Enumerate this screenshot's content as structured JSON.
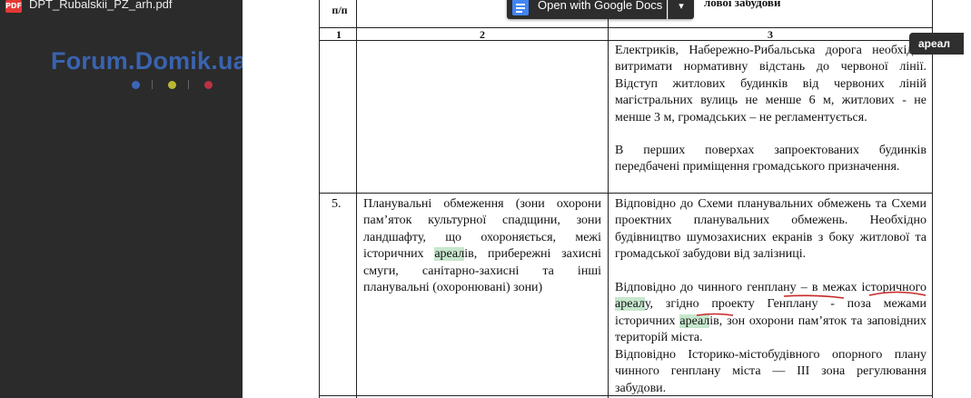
{
  "viewer": {
    "file_name": "DPT_Rubalskii_PZ_arh.pdf",
    "file_badge": "PDF",
    "open_with_label": "Open with Google Docs",
    "dropdown_glyph": "▾",
    "search_term": "ареал"
  },
  "watermark": {
    "text": "Forum.Domik.ua",
    "dot_colors": [
      "#3b66b8",
      "#b8b832",
      "#b83244"
    ]
  },
  "table": {
    "header_col1": "п/п",
    "header_partial_title": "лової забудови",
    "col_numbers": [
      "1",
      "2",
      "3"
    ],
    "row4_col3": "Електриків, Набережно-Рибальська дорога необхідно витримати нормативну відстань до червоної лінії. Відступ житлових будинків від червоних ліній магістральних вулиць не менше 6 м, житлових - не менше 3 м, громадських – не регламентується.",
    "row4_col3_b": "В перших поверхах запроектованих будинків передбачені приміщення громадського призначення.",
    "row5_num": "5.",
    "row5_col2_a": "Планувальні обмеження (зони охорони пам’яток культурної спадщини, зони ландшафту, що охороняється, межі історичних ",
    "row5_col2_hl": "ареал",
    "row5_col2_b": "ів, прибережні захисні смуги, санітарно-захисні та інші планувальні (охоронювані) зони)",
    "row5_col3_a": "Відповідно до Схеми планувальних обмежень та Схеми проектних планувальних обмежень. Необхідно будівництво шумозахисних екранів з боку житлової та громадської забудови від залізниці.",
    "row5_col3_b1": "Відповідно до чинного генплану – в межах історичного ",
    "row5_col3_hl1": "ареал",
    "row5_col3_b2": "у, згідно проекту Генплану - поза межами історичних ",
    "row5_col3_hl2": "ареал",
    "row5_col3_b3": "ів, зон охорони пам’яток та заповідних територій міста.",
    "row5_col3_c": "Відповідно Історико-містобудівного опорного плану чинного генплану міста — ІІІ зона регулювання забудови."
  }
}
